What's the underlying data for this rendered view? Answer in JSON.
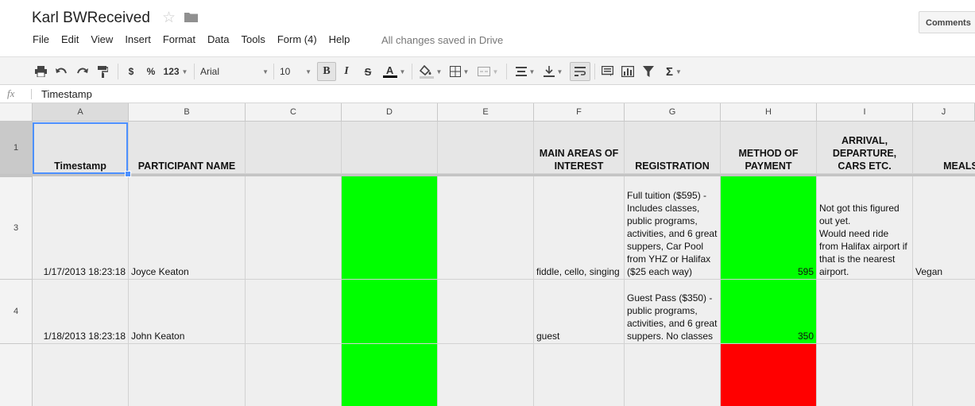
{
  "header": {
    "title": "Karl BWReceived",
    "comments_label": "Comments",
    "save_status": "All changes saved in Drive"
  },
  "menu": [
    "File",
    "Edit",
    "View",
    "Insert",
    "Format",
    "Data",
    "Tools",
    "Form (4)",
    "Help"
  ],
  "toolbar": {
    "currency_label": "$",
    "percent_label": "%",
    "number_format_label": "123",
    "font_name": "Arial",
    "font_size": "10",
    "bold_label": "B",
    "italic_label": "I",
    "strike_label": "S",
    "text_color_label": "A",
    "sum_label": "Σ"
  },
  "formula_bar": {
    "fx_label": "fx",
    "value": "Timestamp"
  },
  "columns": [
    "A",
    "B",
    "C",
    "D",
    "E",
    "F",
    "G",
    "H",
    "I",
    "J"
  ],
  "rows": [
    "1",
    "3",
    "4"
  ],
  "header_row": [
    "Timestamp",
    "PARTICIPANT NAME",
    "",
    "",
    "",
    "MAIN AREAS OF INTEREST",
    "REGISTRATION",
    "METHOD OF PAYMENT",
    "ARRIVAL, DEPARTURE, CARS ETC.",
    "MEALS"
  ],
  "data_rows": [
    [
      "1/17/2013 18:23:18",
      "Joyce Keaton",
      "",
      "",
      "",
      "fiddle, cello, singing",
      "Full tuition ($595) - Includes classes, public programs, activities, and 6 great suppers, Car Pool from YHZ or Halifax ($25 each way)",
      "595",
      "Not got this figured out yet.\nWould need ride from Halifax airport if that is the nearest airport.",
      "Vegan"
    ],
    [
      "1/18/2013 18:23:18",
      "John Keaton",
      "",
      "",
      "",
      "guest",
      "Guest Pass ($350) - public programs, activities, and 6 great suppers. No classes",
      "350",
      "",
      ""
    ]
  ],
  "colors": {
    "green_fill": "#00ff00",
    "red_fill": "#ff0000",
    "selection": "#4d90fe"
  }
}
